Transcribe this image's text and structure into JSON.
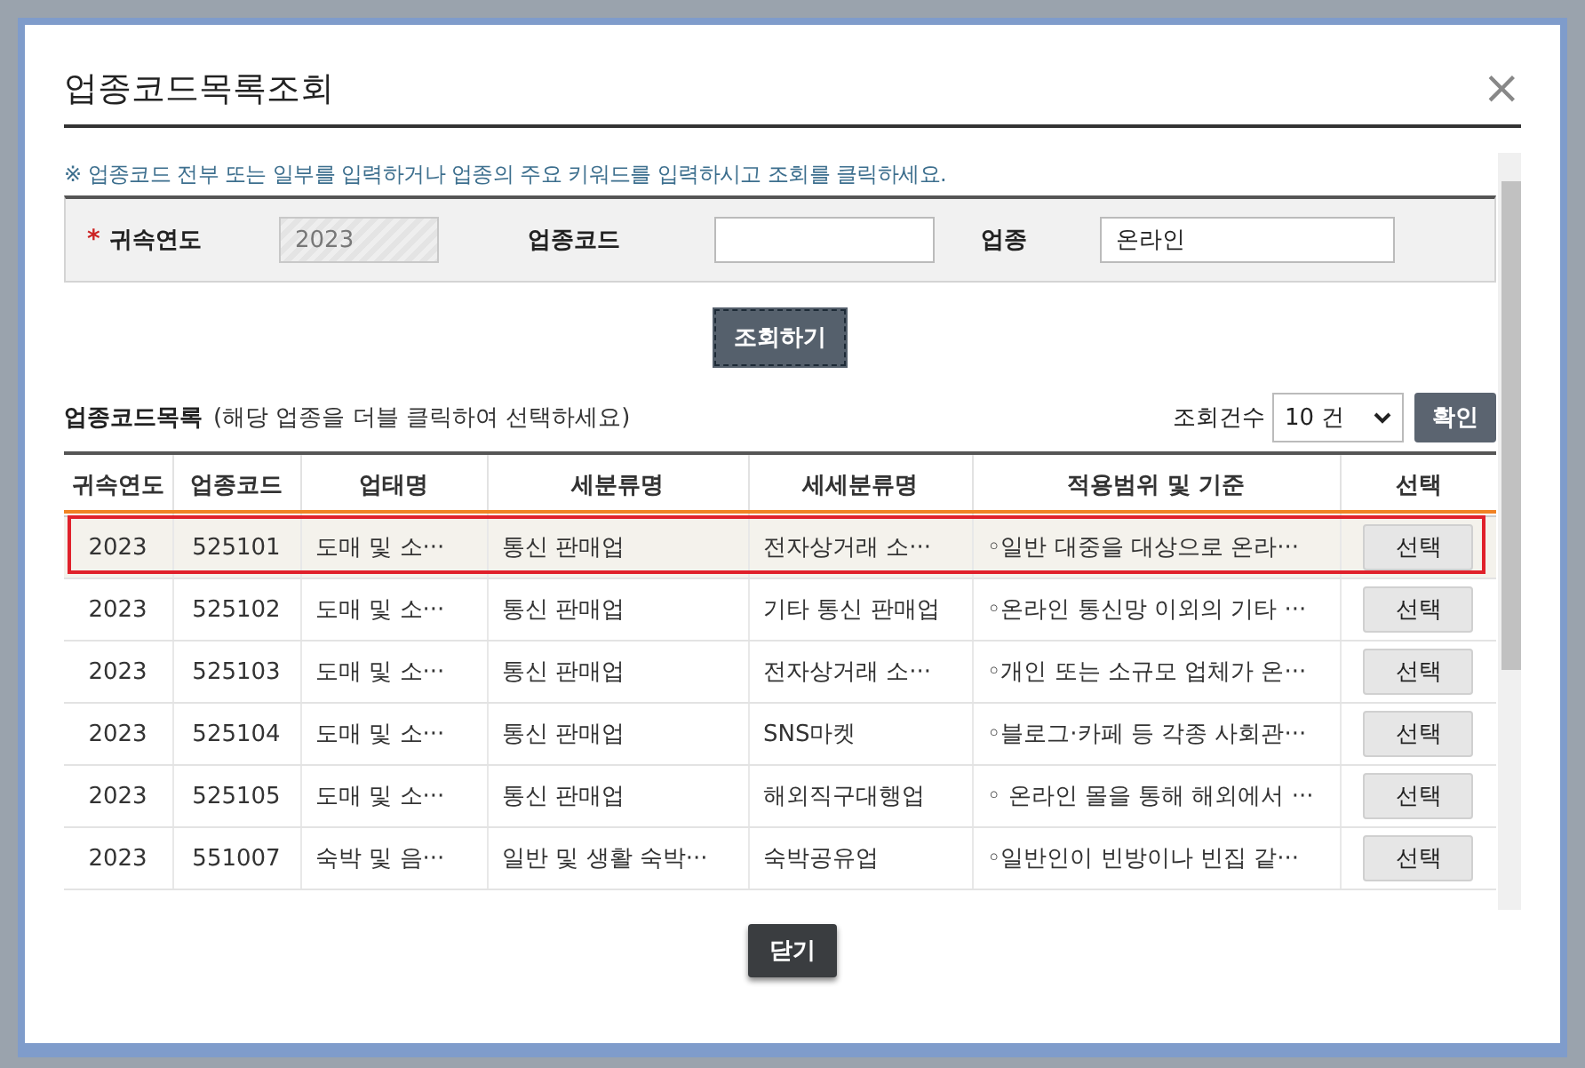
{
  "dialog": {
    "title": "업종코드목록조회",
    "close": "×"
  },
  "notice": "※ 업종코드 전부 또는 일부를 입력하거나 업종의 주요 키워드를 입력하시고 조회를 클릭하세요.",
  "search": {
    "required_mark": "*",
    "fields": [
      {
        "label": "귀속연도",
        "required": true,
        "disabled": true,
        "value": "2023"
      },
      {
        "label": "업종코드",
        "required": false,
        "disabled": false
      },
      {
        "label": "업종",
        "required": false,
        "disabled": false,
        "value": "온라인"
      }
    ],
    "button": "조회하기"
  },
  "list": {
    "title": "업종코드목록",
    "hint": "(해당 업종을 더블 클릭하여 선택하세요)",
    "count_label": "조회건수",
    "count_value": "10 건",
    "confirm": "확인"
  },
  "table": {
    "columns": [
      "귀속연도",
      "업종코드",
      "업태명",
      "세분류명",
      "세세분류명",
      "적용범위 및 기준",
      "선택"
    ],
    "rows": [
      {
        "highlighted": true,
        "cells": [
          "2023",
          "525101",
          "도매 및 소···",
          "통신 판매업",
          "전자상거래 소···",
          "◦일반 대중을 대상으로 온라···"
        ],
        "action": "선택"
      },
      {
        "highlighted": false,
        "cells": [
          "2023",
          "525102",
          "도매 및 소···",
          "통신 판매업",
          "기타 통신 판매업",
          "◦온라인 통신망 이외의 기타 ···"
        ],
        "action": "선택"
      },
      {
        "highlighted": false,
        "cells": [
          "2023",
          "525103",
          "도매 및 소···",
          "통신 판매업",
          "전자상거래 소···",
          "◦개인 또는 소규모 업체가 온···"
        ],
        "action": "선택"
      },
      {
        "highlighted": false,
        "cells": [
          "2023",
          "525104",
          "도매 및 소···",
          "통신 판매업",
          "SNS마켓",
          "◦블로그·카페 등 각종 사회관···"
        ],
        "action": "선택"
      },
      {
        "highlighted": false,
        "cells": [
          "2023",
          "525105",
          "도매 및 소···",
          "통신 판매업",
          "해외직구대행업",
          "◦ 온라인 몰을 통해 해외에서 ···"
        ],
        "action": "선택"
      },
      {
        "highlighted": false,
        "cells": [
          "2023",
          "551007",
          "숙박 및 음···",
          "일반 및 생활 숙박···",
          "숙박공유업",
          "◦일반인이 빈방이나 빈집 같···"
        ],
        "action": "선택"
      }
    ]
  },
  "close_button": "닫기"
}
